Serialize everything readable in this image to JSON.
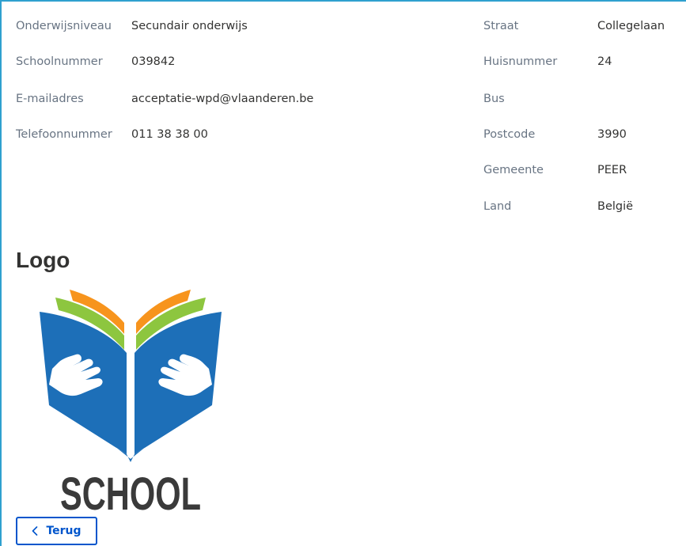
{
  "details_left": [
    {
      "label": "Onderwijsniveau",
      "value": "Secundair onderwijs"
    },
    {
      "label": "Schoolnummer",
      "value": "039842"
    },
    {
      "label": "E-mailadres",
      "value": "acceptatie-wpd@vlaanderen.be"
    },
    {
      "label": "Telefoonnummer",
      "value": "011 38 38 00"
    }
  ],
  "details_right": [
    {
      "label": "Straat",
      "value": "Collegelaan"
    },
    {
      "label": "Huisnummer",
      "value": "24"
    },
    {
      "label": "Bus",
      "value": ""
    },
    {
      "label": "Postcode",
      "value": "3990"
    },
    {
      "label": "Gemeente",
      "value": "PEER"
    },
    {
      "label": "Land",
      "value": "België"
    }
  ],
  "logo_section": {
    "title": "Logo",
    "logo_text": "SCHOOL",
    "logo_icon": "open-book-with-hands-icon",
    "colors": {
      "blue": "#1d6fb8",
      "green": "#8dc63f",
      "orange": "#f7941d",
      "text": "#3a3a3a"
    }
  },
  "actions": {
    "back_label": "Terug",
    "back_icon": "chevron-left-icon"
  },
  "colors": {
    "frame_border": "#2fa0cf",
    "label": "#687483",
    "value": "#333332",
    "link": "#0055cc"
  }
}
